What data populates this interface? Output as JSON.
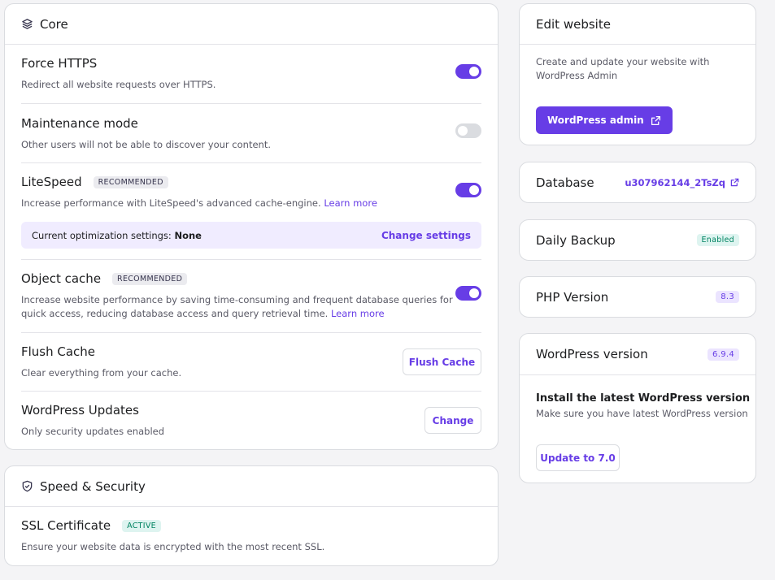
{
  "core": {
    "title": "Core",
    "force_https": {
      "title": "Force HTTPS",
      "desc": "Redirect all website requests over HTTPS.",
      "enabled": true
    },
    "maintenance": {
      "title": "Maintenance mode",
      "desc": "Other users will not be able to discover your content.",
      "enabled": false
    },
    "litespeed": {
      "title": "LiteSpeed",
      "badge": "RECOMMENDED",
      "desc": "Increase performance with LiteSpeed's advanced cache-engine.",
      "learn_more": "Learn more",
      "enabled": true,
      "settings_label": "Current optimization settings:",
      "settings_value": "None",
      "change_settings": "Change settings"
    },
    "object_cache": {
      "title": "Object cache",
      "badge": "RECOMMENDED",
      "desc": "Increase website performance by saving time-consuming and frequent database queries for quick access, reducing database access and query retrieval time.",
      "learn_more": "Learn more",
      "enabled": true
    },
    "flush_cache": {
      "title": "Flush Cache",
      "desc": "Clear everything from your cache.",
      "button": "Flush Cache"
    },
    "wp_updates": {
      "title": "WordPress Updates",
      "desc": "Only security updates enabled",
      "button": "Change"
    }
  },
  "speed_security": {
    "title": "Speed & Security",
    "ssl": {
      "title": "SSL Certificate",
      "badge": "ACTIVE",
      "desc": "Ensure your website data is encrypted with the most recent SSL."
    }
  },
  "edit_website": {
    "title": "Edit website",
    "desc": "Create and update your website with WordPress Admin",
    "button": "WordPress admin"
  },
  "database": {
    "title": "Database",
    "value": "u307962144_2TsZq"
  },
  "daily_backup": {
    "title": "Daily Backup",
    "badge": "Enabled"
  },
  "php": {
    "title": "PHP Version",
    "badge": "8.3"
  },
  "wp_version": {
    "title": "WordPress version",
    "badge": "6.9.4",
    "install_title": "Install the latest WordPress version",
    "install_desc": "Make sure you have latest WordPress version",
    "button": "Update to 7.0"
  },
  "colors": {
    "accent": "#673de6",
    "success": "#008361",
    "border": "#dadce0"
  }
}
